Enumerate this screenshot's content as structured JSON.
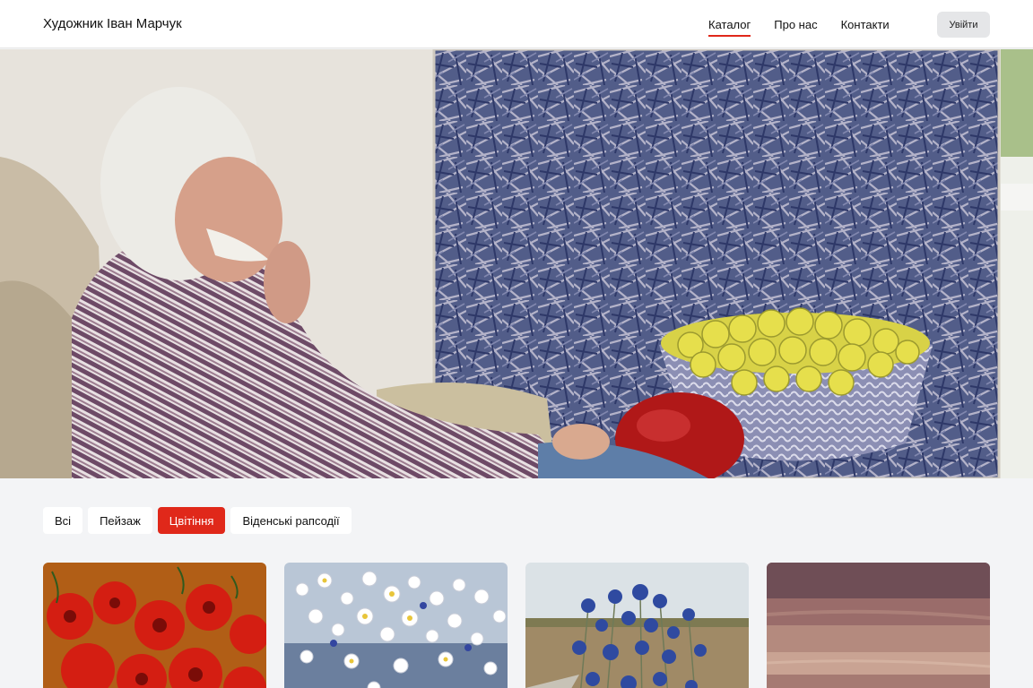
{
  "header": {
    "brand": "Художник Іван Марчук",
    "nav": [
      {
        "label": "Каталог",
        "active": true
      },
      {
        "label": "Про нас",
        "active": false
      },
      {
        "label": "Контакти",
        "active": false
      }
    ],
    "login_label": "Увійти"
  },
  "filters": [
    {
      "label": "Всі",
      "active": false
    },
    {
      "label": "Пейзаж",
      "active": false
    },
    {
      "label": "Цвітіння",
      "active": true
    },
    {
      "label": "Віденські рапсодії",
      "active": false
    }
  ],
  "colors": {
    "accent": "#e0281a",
    "page_background": "#f3f4f6",
    "chip_background": "#ffffff",
    "login_button_background": "#e5e6e8"
  }
}
